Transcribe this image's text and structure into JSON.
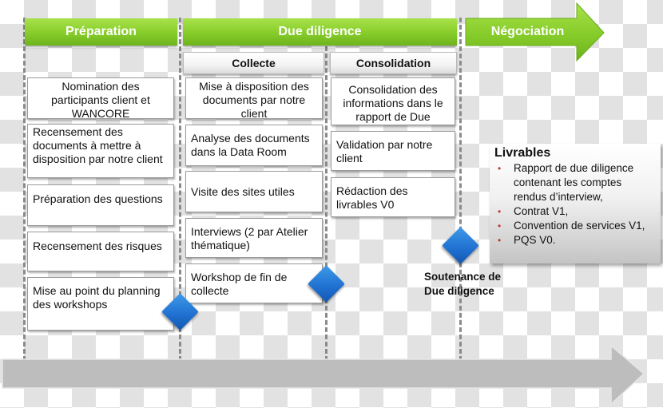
{
  "phases": [
    {
      "label": "Préparation"
    },
    {
      "label": "Due diligence"
    },
    {
      "label": "Négociation"
    }
  ],
  "subphases": [
    {
      "label": "Collecte"
    },
    {
      "label": "Consolidation"
    }
  ],
  "preparation_tasks": [
    {
      "label": "Nomination des participants client et WANCORE"
    },
    {
      "label": "Recensement des documents à mettre à disposition par notre client"
    },
    {
      "label": "Préparation des questions"
    },
    {
      "label": "Recensement des risques"
    },
    {
      "label": "Mise au point du planning des workshops"
    }
  ],
  "collecte_tasks": [
    {
      "label": "Mise à disposition des documents par notre client"
    },
    {
      "label": "Analyse des documents dans la Data Room"
    },
    {
      "label": "Visite des sites utiles"
    },
    {
      "label": "Interviews (2 par Atelier thématique)"
    },
    {
      "label": "Workshop de fin de collecte"
    }
  ],
  "consolidation_tasks": [
    {
      "label": "Consolidation des informations dans le rapport de Due"
    },
    {
      "label": "Validation par notre client"
    },
    {
      "label": "Rédaction des livrables V0"
    }
  ],
  "milestone": {
    "label": "Soutenance de Due diligence"
  },
  "deliverables": {
    "title": "Livrables",
    "items": [
      "Rapport de due diligence contenant les comptes rendus d’interview,",
      "Contrat V1,",
      "Convention de services V1,",
      "PQS V0."
    ]
  },
  "colors": {
    "phase_green": "#86cc2a",
    "milestone_blue": "#1f6fd0",
    "timeline_gray": "#bdbdbd",
    "bullet_red": "#c0392b"
  }
}
